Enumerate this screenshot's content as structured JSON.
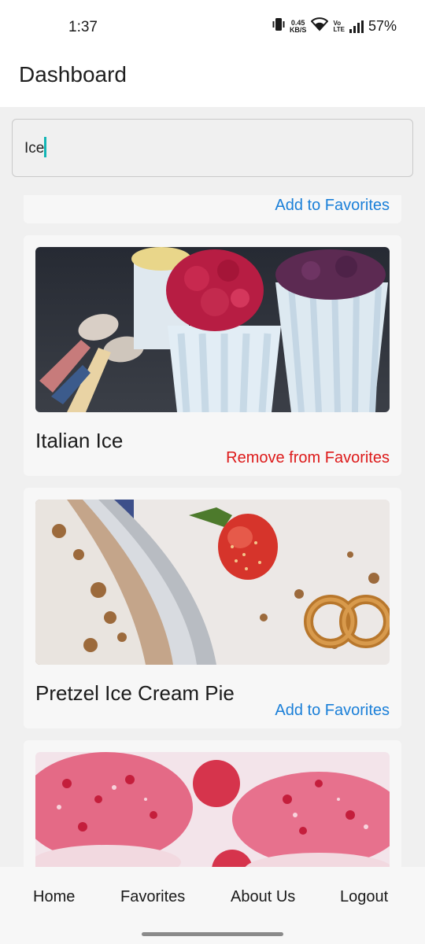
{
  "status_bar": {
    "time": "1:37",
    "net_speed_value": "0.45",
    "net_speed_unit": "KB/S",
    "volte_top": "Vo",
    "volte_bottom": "LTE",
    "battery": "57%"
  },
  "header": {
    "title": "Dashboard"
  },
  "search": {
    "value": "Ice"
  },
  "recipes": [
    {
      "title": "",
      "action_label": "Add to Favorites",
      "is_favorite": false
    },
    {
      "title": "Italian Ice",
      "action_label": "Remove from Favorites",
      "is_favorite": true
    },
    {
      "title": "Pretzel Ice Cream Pie",
      "action_label": "Add to Favorites",
      "is_favorite": false
    },
    {
      "title": "",
      "action_label": "",
      "is_favorite": false
    }
  ],
  "bottom_nav": {
    "items": [
      {
        "label": "Home"
      },
      {
        "label": "Favorites"
      },
      {
        "label": "About Us"
      },
      {
        "label": "Logout"
      }
    ]
  },
  "colors": {
    "add_action": "#1a7fd8",
    "remove_action": "#dd1a1a",
    "cursor": "#12b5b5"
  }
}
